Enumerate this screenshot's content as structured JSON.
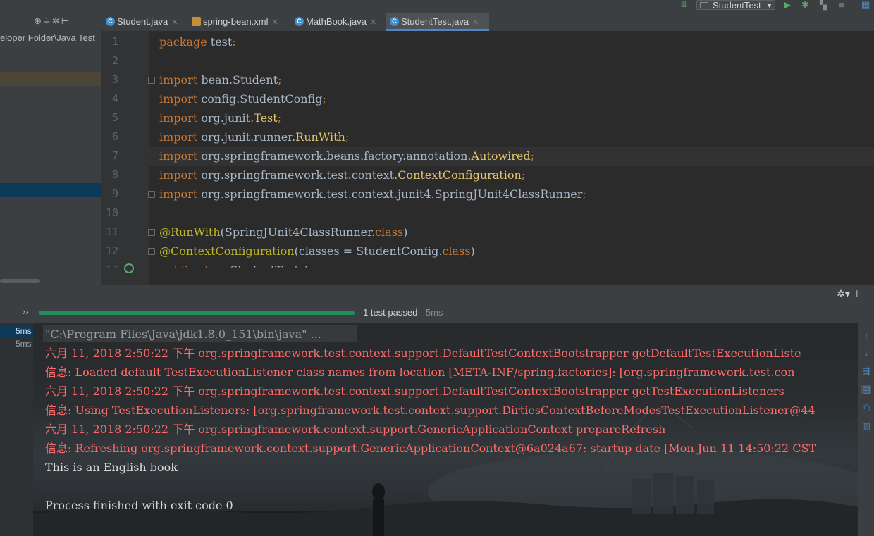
{
  "toolbar": {
    "run_config": "StudentTest",
    "colors": {
      "run": "#59a869",
      "accent": "#4a88c7"
    }
  },
  "tabs": [
    {
      "label": "Student.java",
      "icon": "class-icon",
      "active": false
    },
    {
      "label": "spring-bean.xml",
      "icon": "xml-file-icon",
      "active": false
    },
    {
      "label": "MathBook.java",
      "icon": "class-icon",
      "active": false
    },
    {
      "label": "StudentTest.java",
      "icon": "class-icon",
      "active": true
    }
  ],
  "project": {
    "path": "eloper Folder\\Java Test"
  },
  "editor": {
    "line_numbers": [
      "1",
      "2",
      "3",
      "4",
      "5",
      "6",
      "7",
      "8",
      "9",
      "10",
      "11",
      "12"
    ],
    "lines": [
      {
        "kw": "package",
        "rest": " test",
        "semi": ";"
      },
      {
        "kw": "",
        "rest": "",
        "semi": ""
      },
      {
        "kw": "import",
        "rest": " bean.Student",
        "semi": ";"
      },
      {
        "kw": "import",
        "rest": " config.StudentConfig",
        "semi": ";"
      },
      {
        "kw": "import",
        "rest": " org.junit.",
        "hl": "Test",
        "semi": ";"
      },
      {
        "kw": "import",
        "rest": " org.junit.runner.",
        "hl": "RunWith",
        "semi": ";"
      },
      {
        "kw": "import",
        "rest": " org.springframework.beans.factory.annotation.",
        "hl": "Autowired",
        "semi": ";"
      },
      {
        "kw": "import",
        "rest": " org.springframework.test.context.",
        "hl": "ContextConfiguration",
        "semi": ";"
      },
      {
        "kw": "import",
        "rest": " org.springframework.test.context.junit4.SpringJUnit4ClassRunner",
        "semi": ";"
      },
      {
        "kw": "",
        "rest": "",
        "semi": ""
      },
      {
        "ann": "@RunWith",
        "rest": "(SpringJUnit4ClassRunner.",
        "kw2": "class",
        "tail": ")"
      },
      {
        "ann": "@ContextConfiguration",
        "rest": "(classes = StudentConfig.",
        "kw2": "class",
        "tail": ")"
      }
    ],
    "partial_line": "public class StudentTest {"
  },
  "run": {
    "status": "1 test passed",
    "duration": " - 5ms",
    "progress": 1.0,
    "tree_times": [
      "5ms",
      "5ms"
    ]
  },
  "console": [
    {
      "type": "gray",
      "text": "\"C:\\Program Files\\Java\\jdk1.8.0_151\\bin\\java\" ..."
    },
    {
      "type": "red",
      "text": "六月 11, 2018 2:50:22 下午 org.springframework.test.context.support.DefaultTestContextBootstrapper getDefaultTestExecutionListe"
    },
    {
      "type": "red",
      "text": "信息: Loaded default TestExecutionListener class names from location [META-INF/spring.factories]: [org.springframework.test.con"
    },
    {
      "type": "red",
      "text": "六月 11, 2018 2:50:22 下午 org.springframework.test.context.support.DefaultTestContextBootstrapper getTestExecutionListeners"
    },
    {
      "type": "red",
      "text": "信息: Using TestExecutionListeners: [org.springframework.test.context.support.DirtiesContextBeforeModesTestExecutionListener@44"
    },
    {
      "type": "red",
      "text": "六月 11, 2018 2:50:22 下午 org.springframework.context.support.GenericApplicationContext prepareRefresh"
    },
    {
      "type": "red",
      "text": "信息: Refreshing org.springframework.context.support.GenericApplicationContext@6a024a67: startup date [Mon Jun 11 14:50:22 CST "
    },
    {
      "type": "white",
      "text": "This is an English book"
    },
    {
      "type": "white",
      "text": ""
    },
    {
      "type": "white",
      "text": "Process finished with exit code 0"
    }
  ]
}
